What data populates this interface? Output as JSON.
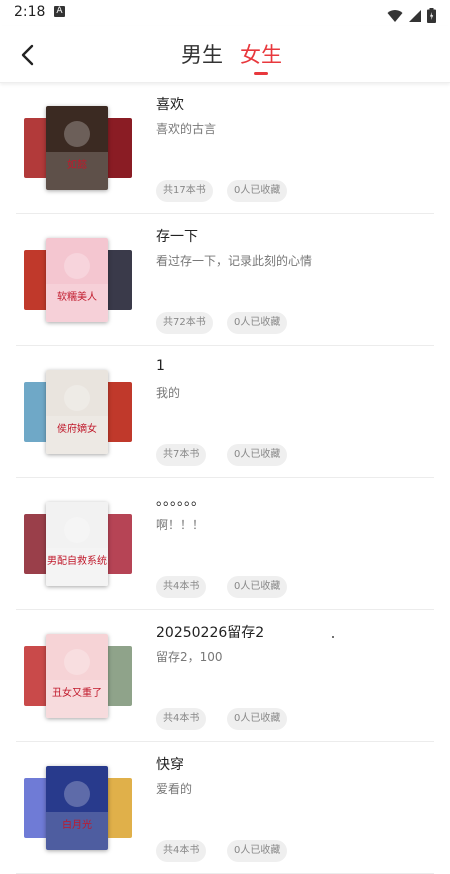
{
  "status_bar": {
    "time": "2:18",
    "notif_letter": "A"
  },
  "header": {
    "tabs": [
      {
        "label": "男生",
        "active": false
      },
      {
        "label": "女生",
        "active": true
      }
    ],
    "accent_color": "#e8383d"
  },
  "lists": [
    {
      "title": "喜欢",
      "desc": "喜欢的古言",
      "count": "共17本书",
      "fav": "0人已收藏",
      "covers": {
        "left": "#b23a3a",
        "main": "#3b2a22",
        "right": "#8a1c24",
        "main_text": "如懿"
      }
    },
    {
      "title": "存一下",
      "desc": "看过存一下，记录此刻的心情",
      "count": "共72本书",
      "fav": "0人已收藏",
      "covers": {
        "left": "#c0392b",
        "main": "#f4c6d0",
        "right": "#3a3a4a",
        "main_text": "软糯美人"
      }
    },
    {
      "title": "1",
      "desc": "我的",
      "count": "共7本书",
      "fav": "0人已收藏",
      "covers": {
        "left": "#6fa8c7",
        "main": "#e9e4de",
        "right": "#c0392b",
        "main_text": "侯府嫡女"
      }
    },
    {
      "title": "。。。。。。",
      "desc": "啊！！！",
      "count": "共4本书",
      "fav": "0人已收藏",
      "covers": {
        "left": "#9a3f4a",
        "main": "#f2f2f2",
        "right": "#b64455",
        "main_text": "男配自救系统"
      }
    },
    {
      "title": "20250226留存2",
      "desc": "留存2，100",
      "count": "共4本书",
      "fav": "0人已收藏",
      "covers": {
        "left": "#c94a4a",
        "main": "#f6d3d6",
        "right": "#8fa38a",
        "main_text": "丑女又重了"
      }
    },
    {
      "title": "快穿",
      "desc": "爱看的",
      "count": "共4本书",
      "fav": "0人已收藏",
      "covers": {
        "left": "#6f7bd6",
        "main": "#283a8c",
        "right": "#e0b04a",
        "main_text": "白月光"
      }
    }
  ]
}
